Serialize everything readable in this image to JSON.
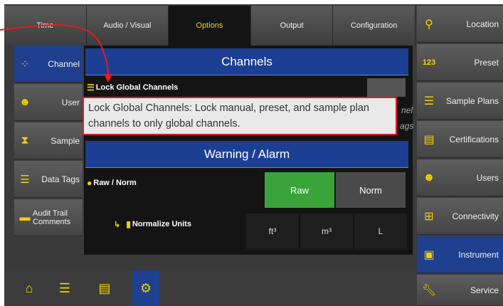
{
  "tabs": [
    {
      "label": "Time"
    },
    {
      "label": "Audio / Visual"
    },
    {
      "label": "Options"
    },
    {
      "label": "Output"
    },
    {
      "label": "Configuration"
    }
  ],
  "left_sidebar": [
    {
      "label": "Channel",
      "icon": "channel-icon"
    },
    {
      "label": "User",
      "icon": "user-icon"
    },
    {
      "label": "Sample",
      "icon": "hourglass-icon"
    },
    {
      "label": "Data Tags",
      "icon": "list-icon"
    },
    {
      "label": "Audit Trail Comments",
      "icon": "comment-icon"
    }
  ],
  "main": {
    "channels_header": "Channels",
    "lock_global_label": "Lock Global Channels",
    "right_fragments": [
      "nel",
      "ags"
    ],
    "tooltip_text": "Lock Global Channels: Lock manual, preset, and sample plan channels to only global channels.",
    "warning_header": "Warning / Alarm",
    "raw_norm_label": "Raw / Norm",
    "raw_button": "Raw",
    "norm_button": "Norm",
    "normalize_units_label": "Normalize Units",
    "units": [
      "ft³",
      "m³",
      "L"
    ]
  },
  "right_sidebar": [
    {
      "label": "Location",
      "icon": "location-pin-icon"
    },
    {
      "label": "Preset",
      "icon": "preset-123-icon"
    },
    {
      "label": "Sample Plans",
      "icon": "list-lines-icon"
    },
    {
      "label": "Certifications",
      "icon": "certificate-icon"
    },
    {
      "label": "Users",
      "icon": "users-icon"
    },
    {
      "label": "Connectivity",
      "icon": "network-icon"
    },
    {
      "label": "Instrument",
      "icon": "instrument-icon"
    },
    {
      "label": "Service",
      "icon": "wrench-icon"
    }
  ],
  "bottom_bar": [
    {
      "icon": "home-icon"
    },
    {
      "icon": "list-icon"
    },
    {
      "icon": "document-icon"
    },
    {
      "icon": "gear-icon"
    }
  ],
  "colors": {
    "accent_yellow": "#f5d000",
    "active_blue": "#1f3f8f",
    "header_blue": "#1c3f94",
    "toggle_green": "#3aa33a",
    "annotation_red": "#e11c1c"
  }
}
